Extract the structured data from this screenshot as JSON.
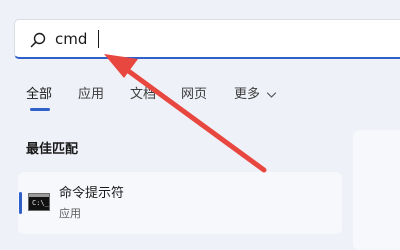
{
  "search": {
    "query": "cmd"
  },
  "tabs": [
    {
      "label": "全部",
      "active": true
    },
    {
      "label": "应用",
      "active": false
    },
    {
      "label": "文档",
      "active": false
    },
    {
      "label": "网页",
      "active": false
    },
    {
      "label": "更多",
      "active": false
    }
  ],
  "best_match": {
    "title": "最佳匹配",
    "result": {
      "name": "命令提示符",
      "type": "应用",
      "icon": "command-prompt-icon"
    }
  },
  "icons": {
    "search": "search-icon",
    "more": "chevron-down-icon"
  },
  "colors": {
    "accent": "#2f5fc9",
    "annotation": "#e8473f",
    "background": "#eef1f7"
  }
}
